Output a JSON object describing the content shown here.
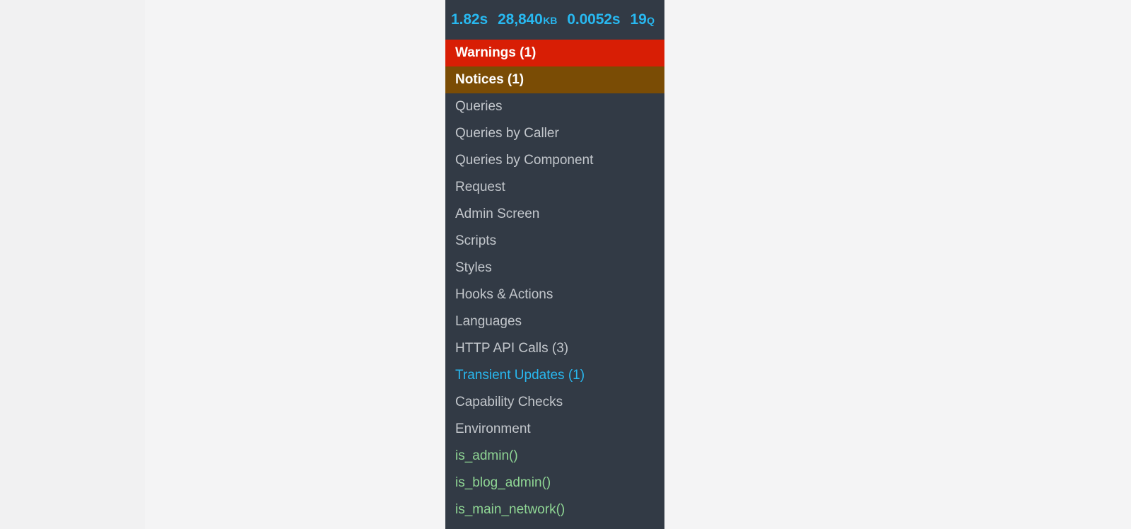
{
  "panel": {
    "name": "query-monitor-debug-bar",
    "header": {
      "metrics": [
        {
          "value": "1.82",
          "unit": "s",
          "unit_small": false,
          "name": "page-generation-time"
        },
        {
          "value": "28,840",
          "unit": "KB",
          "unit_small": true,
          "name": "peak-memory-usage"
        },
        {
          "value": "0.0052",
          "unit": "s",
          "unit_small": false,
          "name": "database-query-time"
        },
        {
          "value": "19",
          "unit": "Q",
          "unit_small": true,
          "name": "database-query-count"
        }
      ]
    },
    "menu": [
      {
        "label": "Warnings (1)",
        "style": "warning",
        "name": "menu-item-warnings"
      },
      {
        "label": "Notices (1)",
        "style": "notice",
        "name": "menu-item-notices"
      },
      {
        "label": "Queries",
        "style": "normal",
        "name": "menu-item-queries"
      },
      {
        "label": "Queries by Caller",
        "style": "normal",
        "name": "menu-item-queries-by-caller"
      },
      {
        "label": "Queries by Component",
        "style": "normal",
        "name": "menu-item-queries-by-component"
      },
      {
        "label": "Request",
        "style": "normal",
        "name": "menu-item-request"
      },
      {
        "label": "Admin Screen",
        "style": "normal",
        "name": "menu-item-admin-screen"
      },
      {
        "label": "Scripts",
        "style": "normal",
        "name": "menu-item-scripts"
      },
      {
        "label": "Styles",
        "style": "normal",
        "name": "menu-item-styles"
      },
      {
        "label": "Hooks & Actions",
        "style": "normal",
        "name": "menu-item-hooks-and-actions"
      },
      {
        "label": "Languages",
        "style": "normal",
        "name": "menu-item-languages"
      },
      {
        "label": "HTTP API Calls (3)",
        "style": "normal",
        "name": "menu-item-http-api-calls"
      },
      {
        "label": "Transient Updates (1)",
        "style": "highlight",
        "name": "menu-item-transient-updates"
      },
      {
        "label": "Capability Checks",
        "style": "normal",
        "name": "menu-item-capability-checks"
      },
      {
        "label": "Environment",
        "style": "normal",
        "name": "menu-item-environment"
      },
      {
        "label": "is_admin()",
        "style": "fn",
        "name": "menu-item-is-admin"
      },
      {
        "label": "is_blog_admin()",
        "style": "fn",
        "name": "menu-item-is-blog-admin"
      },
      {
        "label": "is_main_network()",
        "style": "fn",
        "name": "menu-item-is-main-network"
      }
    ]
  },
  "colors": {
    "panel_background": "#323a45",
    "warning_background": "#d81e05",
    "notice_background": "#7a4c05",
    "accent_cyan": "#28b8f0",
    "function_green": "#8fd694",
    "text_default": "#c3c7cc",
    "page_background": "#f4f4f5"
  }
}
